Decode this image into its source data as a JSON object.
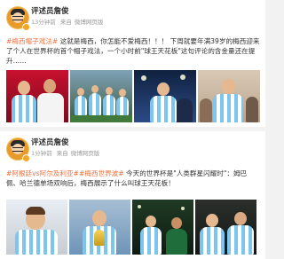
{
  "posts": [
    {
      "username": "评述员詹俊",
      "time": "13分钟前",
      "source": "来自",
      "client": "微博网页版",
      "text": {
        "tag": "#梅西帽子戏法#",
        "body": " 这就是梅西，你怎能不爱梅西！！！ 下周就要年满39岁的梅西迎来了个人在世界杯的首个帽子戏法，一个小时前\"球王天花板\"这句评论的含金量还在提升……"
      },
      "photos": [
        "messi-and-teammate-photo",
        "team-celebration-photo",
        "messi-night-match-photo",
        "messi-crowd-photo"
      ]
    },
    {
      "username": "评述员詹俊",
      "time": "1分钟前",
      "source": "来自",
      "client": "微博网页版",
      "text": {
        "tag1": "#阿根廷vs阿尔及利亚#",
        "tag2": "#梅西世界波#",
        "body_a": " 今天的世界杯是\"人类群星闪耀时\"：姆巴佩、哈兰德单场双响后，梅西展示了什么叫球王天花板！",
        "mention": ""
      },
      "photos": [
        "messi-closeup-photo",
        "messi-with-trophy-photo",
        "messi-scoring-photo",
        "messi-and-teammate-night-photo"
      ]
    }
  ],
  "colors": {
    "tag": "#eb7340",
    "username": "#333333",
    "meta": "#999999",
    "background": "#f2f2f2",
    "card": "#ffffff"
  }
}
